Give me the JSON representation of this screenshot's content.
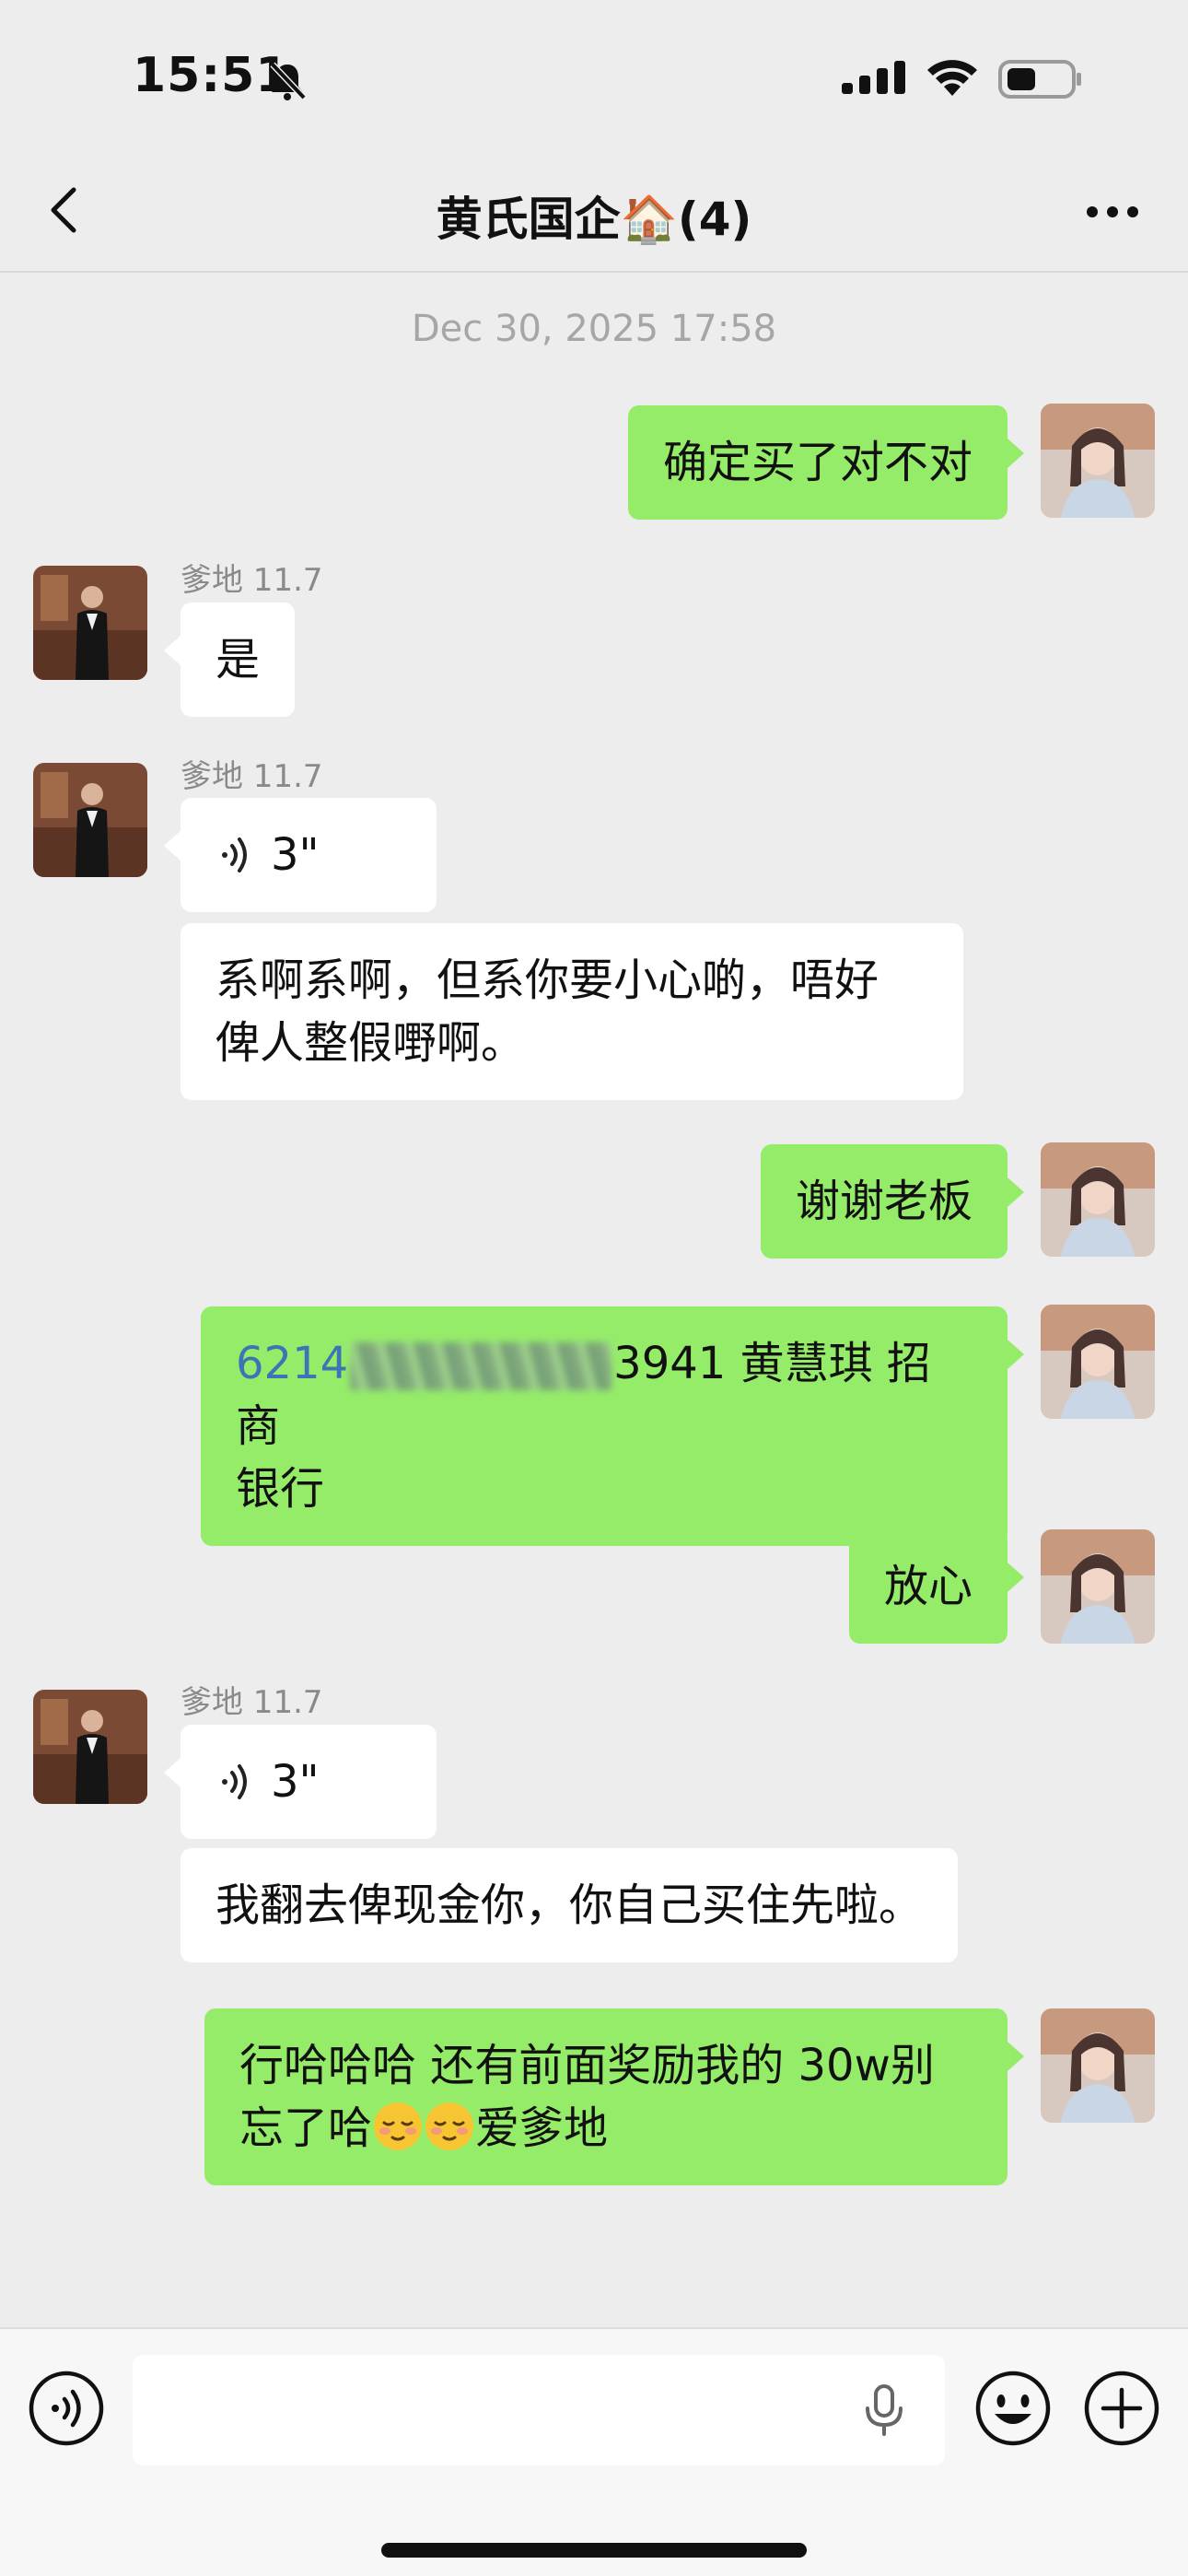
{
  "status_bar": {
    "time": "15:51",
    "icons": [
      "bell-off-icon",
      "signal-icon",
      "wifi-icon",
      "battery-icon"
    ]
  },
  "nav": {
    "title": "黄氏国企🏠(4)",
    "back_icon": "chevron-left-icon",
    "more_icon": "ellipsis-icon"
  },
  "chat": {
    "timestamp": "Dec 30, 2025 17:58",
    "messages": [
      {
        "side": "out",
        "text": "确定买了对不对"
      },
      {
        "side": "in",
        "sender": "爹地 11.7",
        "text": "是"
      },
      {
        "side": "in",
        "sender": "爹地 11.7",
        "voice_duration": "3\""
      },
      {
        "side": "in",
        "text_line1": "系啊系啊，但系你要小心啲，唔好",
        "text_line2": "俾人整假嘢啊。"
      },
      {
        "side": "out",
        "text": "谢谢老板"
      },
      {
        "side": "out",
        "card_prefix": "6214",
        "card_suffix": "3941",
        "text_rest": " 黄慧琪 招商",
        "text_line2": "银行"
      },
      {
        "side": "out",
        "text": "放心"
      },
      {
        "side": "in",
        "sender": "爹地 11.7",
        "voice_duration": "3\""
      },
      {
        "side": "in",
        "text": "我翻去俾现金你，你自己买住先啦。"
      },
      {
        "side": "out",
        "text_line1": "行哈哈哈 还有前面奖励我的 30w别",
        "text_line2_start": "忘了哈",
        "text_line2_end": "爱爹地",
        "emoji": "relieved-face-icon"
      }
    ]
  },
  "input_bar": {
    "voice_icon": "voice-toggle-icon",
    "mic_icon": "microphone-icon",
    "emoji_icon": "smiley-icon",
    "plus_icon": "plus-icon"
  },
  "colors": {
    "background": "#ededed",
    "outgoing_bubble": "#95ec69",
    "incoming_bubble": "#ffffff",
    "link_blue": "#3e73b5"
  }
}
